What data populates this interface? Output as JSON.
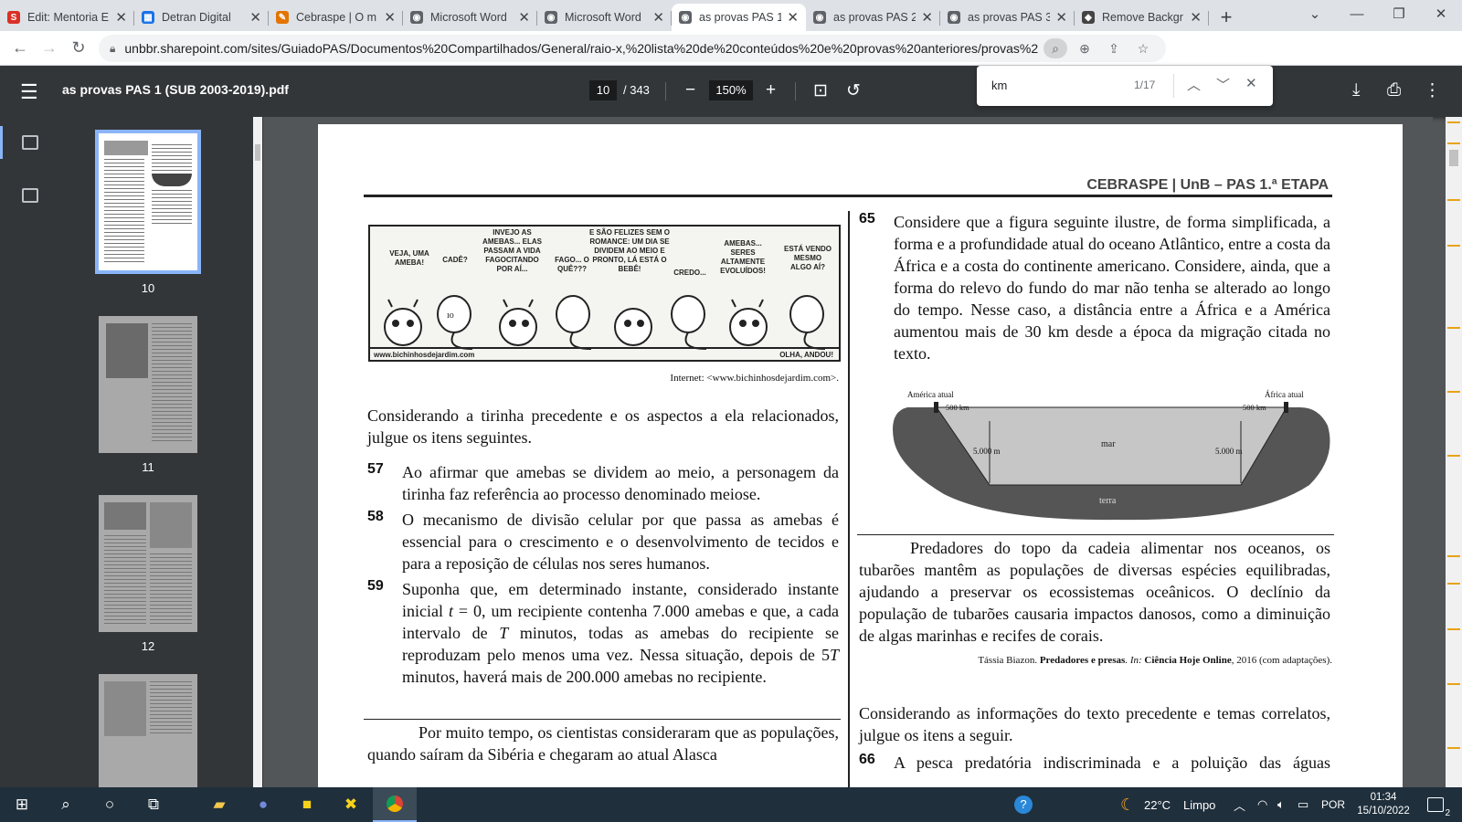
{
  "tabs": [
    {
      "label": "Edit: Mentoria E",
      "color": "#d93025",
      "glyph": "S",
      "active": false
    },
    {
      "label": "Detran Digital",
      "color": "#1a73e8",
      "glyph": "▦",
      "active": false
    },
    {
      "label": "Cebraspe | O m",
      "color": "#e37400",
      "glyph": "✎",
      "active": false
    },
    {
      "label": "Microsoft Word",
      "color": "#5f6368",
      "glyph": "◉",
      "active": false
    },
    {
      "label": "Microsoft Word",
      "color": "#5f6368",
      "glyph": "◉",
      "active": false
    },
    {
      "label": "as provas PAS 1",
      "color": "#5f6368",
      "glyph": "◉",
      "active": true
    },
    {
      "label": "as provas PAS 2",
      "color": "#5f6368",
      "glyph": "◉",
      "active": false
    },
    {
      "label": "as provas PAS 3",
      "color": "#5f6368",
      "glyph": "◉",
      "active": false
    },
    {
      "label": "Remove Backgr",
      "color": "#444",
      "glyph": "◆",
      "active": false
    }
  ],
  "address": {
    "url": "unbbr.sharepoint.com/sites/GuiadoPAS/Documentos%20Compartilhados/General/raio-x,%20lista%20de%20conteúdos%20e%20provas%20anteriores/provas%20anteriores/PAS%2..."
  },
  "pdf": {
    "title": "as provas PAS 1 (SUB 2003-2019).pdf",
    "page": "10",
    "page_total": "/ 343",
    "zoom": "150%"
  },
  "find": {
    "query": "km",
    "count": "1/17"
  },
  "thumbnails": [
    {
      "num": "10",
      "selected": true
    },
    {
      "num": "11",
      "selected": false
    },
    {
      "num": "12",
      "selected": false
    },
    {
      "num": ""
    }
  ],
  "page": {
    "header": "CEBRASPE | UnB – PAS 1.ª ETAPA",
    "comic": {
      "bubbles": [
        "VEJA, UMA AMEBA!",
        "CADÊ?",
        "INVEJO AS AMEBAS... ELAS PASSAM A VIDA FAGOCITANDO POR AÍ...",
        "FAGO... O QUÊ???",
        "E SÃO FELIZES SEM O ROMANCE: UM DIA SE DIVIDEM AO MEIO E PRONTO, LÁ ESTÁ O BEBÊ!",
        "CREDO...",
        "AMEBAS... SERES ALTAMENTE EVOLUÍDOS!",
        "ESTÁ VENDO MESMO ALGO AÍ?"
      ],
      "site": "www.bichinhosdejardim.com",
      "last": "OLHA, ANDOU!"
    },
    "credit": "Internet: <www.bichinhosdejardim.com>.",
    "intro_left": "Considerando a tirinha precedente e os aspectos a ela relacionados, julgue os itens seguintes.",
    "q57": {
      "num": "57",
      "text": "Ao afirmar que amebas se dividem ao meio, a personagem da tirinha faz referência ao processo denominado meiose."
    },
    "q58": {
      "num": "58",
      "text": "O mecanismo de divisão celular por que passa as amebas é essencial para o crescimento e o desenvolvimento de tecidos e para a reposição de células nos seres humanos."
    },
    "q59": {
      "num": "59",
      "text_a": "Suponha que, em determinado instante, considerado instante inicial ",
      "var_t": "t",
      "text_b": " = 0, um recipiente contenha 7.000 amebas e que, a cada intervalo de ",
      "var_T": "T",
      "text_c": " minutos, todas as amebas do recipiente se reproduzam pelo menos uma vez. Nessa situação, depois de 5",
      "var_T2": "T",
      "text_d": " minutos, haverá mais de 200.000 amebas no recipiente."
    },
    "next_para": "Por muito tempo, os cientistas consideraram que as populações, quando saíram da Sibéria e chegaram ao atual Alasca",
    "q65": {
      "num": "65",
      "text": "Considere que a figura seguinte ilustre, de forma simplificada, a forma e a profundidade atual do oceano Atlântico, entre a costa da África e a costa do continente americano. Considere, ainda, que a forma do relevo do fundo do mar não tenha se alterado ao longo do tempo. Nesse caso, a distância entre a África e a América aumentou mais de 30 km desde a época da migração citada no texto."
    },
    "diagram": {
      "america": "América atual",
      "africa": "África atual",
      "km_left": "500 km",
      "km_right": "500 km",
      "depth_left": "5.000 m",
      "depth_right": "5.000 m",
      "sea": "mar",
      "land": "terra"
    },
    "para_right": "Predadores do topo da cadeia alimentar nos oceanos, os tubarões mantêm as populações de diversas espécies equilibradas, ajudando a preservar os ecossistemas oceânicos. O declínio da população de tubarões causaria impactos danosos, como a diminuição de algas marinhas e recifes de corais.",
    "ref": {
      "author": "Tássia Biazon. ",
      "title": "Predadores e presas",
      "in": ". In: ",
      "mag": "Ciência Hoje Online",
      "rest": ", 2016 (com adaptações)."
    },
    "intro_right": "Considerando as informações do texto precedente e temas correlatos, julgue os itens a seguir.",
    "q66": {
      "num": "66",
      "text": "A pesca predatória indiscriminada e a poluição das águas"
    }
  },
  "taskbar": {
    "temp": "22°C",
    "weather": "Limpo",
    "lang": "POR",
    "time": "01:34",
    "date": "15/10/2022",
    "notif": "2"
  }
}
